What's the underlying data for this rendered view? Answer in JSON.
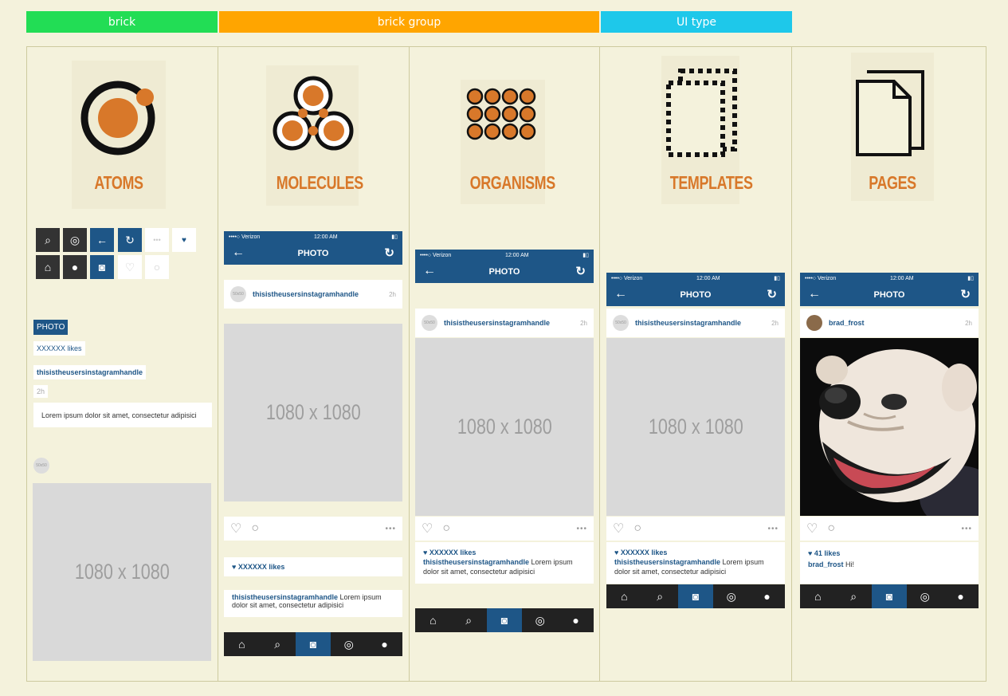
{
  "headers": {
    "brick": "brick",
    "brick_group": "brick group",
    "ui_type": "UI type"
  },
  "colors": {
    "brick": "#22dd55",
    "brick_group": "#ffa500",
    "ui_type": "#1ec8ea",
    "orange": "#d8782a",
    "blue": "#1e5687"
  },
  "columns": {
    "atoms": "ATOMS",
    "molecules": "MOLECULES",
    "organisms": "ORGANISMS",
    "templates": "TEMPLATES",
    "pages": "PAGES"
  },
  "atoms": {
    "photo_label": "PHOTO",
    "likes": "XXXXXX likes",
    "handle": "thisistheusersinstagramhandle",
    "time": "2h",
    "caption": "Lorem ipsum dolor sit amet, consectetur adipisici",
    "placeholder": "1080 x 1080",
    "avatar_placeholder": "50x50"
  },
  "phone": {
    "carrier": "••••○ Verizon",
    "clock": "12:00 AM",
    "title": "PHOTO",
    "back_icon": "←",
    "refresh_icon": "↻",
    "handle": "thisistheusersinstagramhandle",
    "time": "2h",
    "placeholder": "1080 x 1080",
    "likes": "♥ XXXXXX likes",
    "caption_handle": "thisistheusersinstagramhandle",
    "caption_text": " Lorem ipsum dolor sit amet, consectetur adipisici",
    "more": "•••",
    "avatar_placeholder": "50x50"
  },
  "page_instance": {
    "handle": "brad_frost",
    "time": "2h",
    "likes": "♥ 41 likes",
    "caption_handle": "brad_frost",
    "caption_text": " Hi!"
  }
}
